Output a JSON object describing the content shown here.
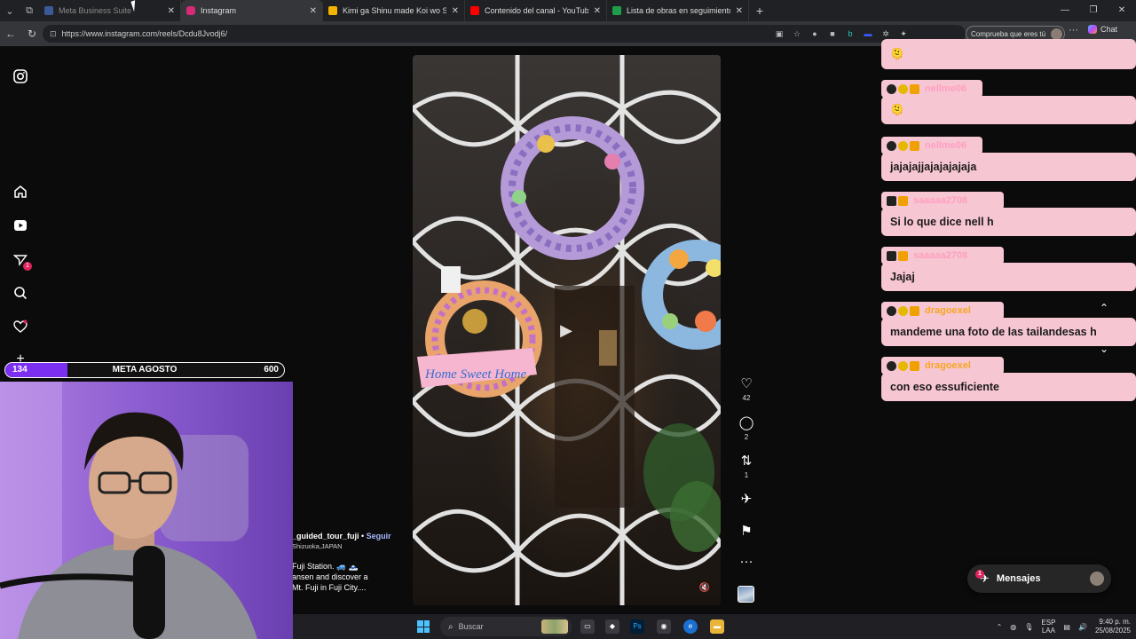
{
  "browser": {
    "tabs": [
      {
        "title": "Meta Business Suite",
        "favicon_color": "#3b5998",
        "active": false,
        "dim": true
      },
      {
        "title": "Instagram",
        "favicon_color": "#d62976",
        "active": true
      },
      {
        "title": "Kimi ga Shinu made Koi wo Shitai",
        "favicon_color": "#f2b400",
        "active": false
      },
      {
        "title": "Contenido del canal - YouTube Studio",
        "favicon_color": "#ff0000",
        "active": false
      },
      {
        "title": "Lista de obras en seguimiento - H",
        "favicon_color": "#1e9e4a",
        "active": false
      }
    ],
    "new_tab": "+",
    "url": "https://www.instagram.com/reels/Dcdu8Jvodj6/",
    "profile_pill": "Comprueba que eres tú",
    "chat_label": "Chat",
    "window_controls": [
      "—",
      "❐",
      "✕"
    ]
  },
  "instagram": {
    "rail_icons": [
      {
        "name": "instagram-logo-icon",
        "glyph": "◎"
      },
      {
        "name": "home-icon",
        "glyph": "⌂"
      },
      {
        "name": "reels-icon",
        "glyph": "▶"
      },
      {
        "name": "messages-icon",
        "glyph": "✈",
        "badge": "1"
      },
      {
        "name": "search-icon",
        "glyph": "⌕"
      },
      {
        "name": "notifications-heart-icon",
        "glyph": "♡"
      },
      {
        "name": "create-plus-icon",
        "glyph": "+"
      }
    ],
    "reel": {
      "actions": [
        {
          "name": "like",
          "glyph": "♡",
          "count": "42"
        },
        {
          "name": "comment",
          "glyph": "◯",
          "count": "2"
        },
        {
          "name": "repost",
          "glyph": "⇅",
          "count": "1"
        },
        {
          "name": "share",
          "glyph": "✈",
          "count": ""
        },
        {
          "name": "save",
          "glyph": "⚑",
          "count": ""
        },
        {
          "name": "more",
          "glyph": "···",
          "count": ""
        }
      ],
      "sign_text": "Home Sweet Home",
      "caption": {
        "username": "_guided_tour_fuji",
        "separator": " • ",
        "follow": "Seguir",
        "location": "Shizuoka,JAPAN",
        "line1": "Fuji Station. 🚙 🗻",
        "line2": "ansen and discover a",
        "line3": "Mt. Fuji in Fuji City...."
      },
      "play_glyph": "▶",
      "mute_glyph": "🔇"
    },
    "messages_button": {
      "label": "Mensajes",
      "badge": "1"
    }
  },
  "chat_overlay": {
    "messages": [
      {
        "user": "",
        "text": "🫠"
      },
      {
        "user": "nellme06",
        "text": "🫠"
      },
      {
        "user": "nellme06",
        "text": "jajajajjajajajajaja"
      },
      {
        "user": "saaaaa2708",
        "text": "Si lo que dice nell h"
      },
      {
        "user": "saaaaa2708",
        "text": "Jajaj"
      },
      {
        "user": "dragoexel",
        "text": "mandeme una foto de las tailandesas h"
      },
      {
        "user": "dragoexel",
        "text": "con eso essuficiente"
      }
    ],
    "name_color": "#ff9fc0",
    "bubble_color": "#f7c6d3",
    "scroll_up_glyph": "⌃",
    "scroll_down_glyph": "⌄"
  },
  "goal_bar": {
    "current": "134",
    "label": "META AGOSTO",
    "target": "600",
    "progress_fraction": 0.223,
    "fill_color": "#7b2ff0"
  },
  "taskbar": {
    "search_placeholder": "Buscar",
    "lang_top": "ESP",
    "lang_bottom": "LAA",
    "time": "9:40 p. m.",
    "date": "25/08/2025"
  }
}
